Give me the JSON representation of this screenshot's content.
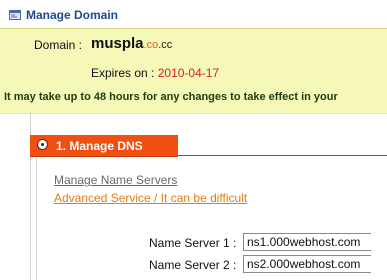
{
  "header": {
    "title": "Manage Domain",
    "icon": "domain-icon"
  },
  "domain_info": {
    "domain_label": "Domain :",
    "domain_name": "muspla",
    "domain_ext_co": ".co",
    "domain_ext_cc": ".cc",
    "expires_label": "Expires on :",
    "expires_date": "2010-04-17",
    "notice": "It may take up to 48 hours for any changes to take effect in your"
  },
  "dns_section": {
    "label": "1. Manage DNS",
    "selected": true,
    "heading": "Manage Name Servers",
    "advanced_link": "Advanced Service / It can be difficult",
    "name_servers": [
      {
        "label": "Name Server 1 :",
        "value": "ns1.000webhost.com"
      },
      {
        "label": "Name Server 2 :",
        "value": "ns2.000webhost.com"
      }
    ]
  },
  "colors": {
    "header_blue": "#1f4a8c",
    "panel_yellow": "#f5f8b7",
    "dns_bar_orange": "#f14e12",
    "expires_red": "#d61f1f",
    "link_orange": "#e07d14"
  }
}
